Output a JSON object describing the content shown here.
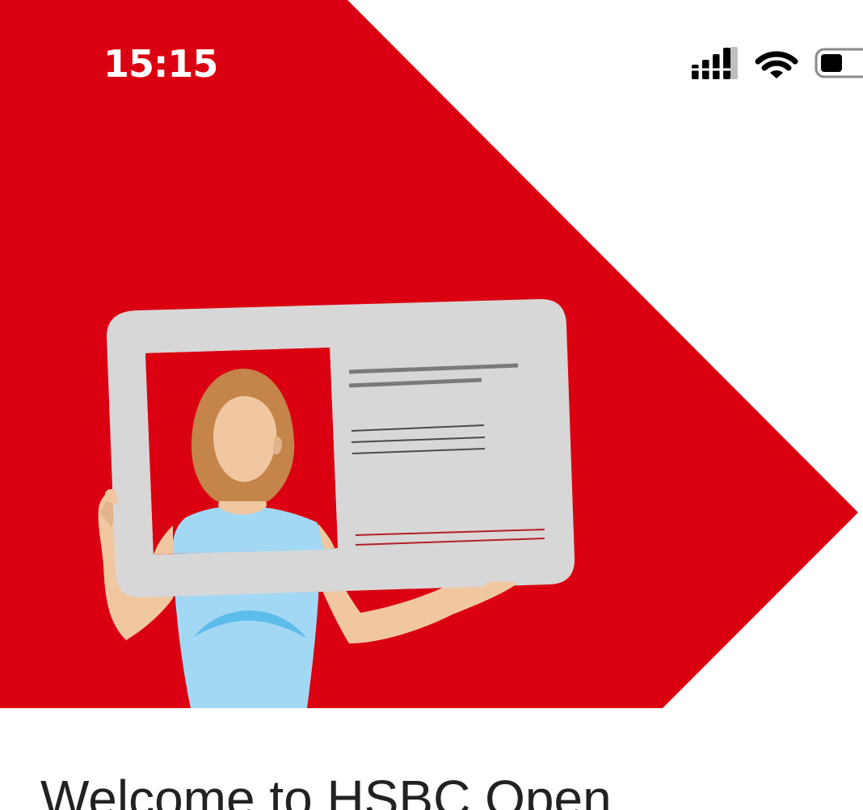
{
  "status_bar": {
    "time": "15:15",
    "icons": [
      "cellular-signal-icon",
      "wifi-icon",
      "battery-icon"
    ]
  },
  "hero": {
    "background_color": "#DB0011",
    "illustration": "woman-holding-id-card-illustration"
  },
  "welcome": {
    "title": "Welcome to HSBC Open"
  },
  "colors": {
    "brand_red": "#DB0011",
    "card_grey": "#D7D7D7",
    "shirt_blue": "#A3D8F4",
    "text_dark": "#222222"
  }
}
